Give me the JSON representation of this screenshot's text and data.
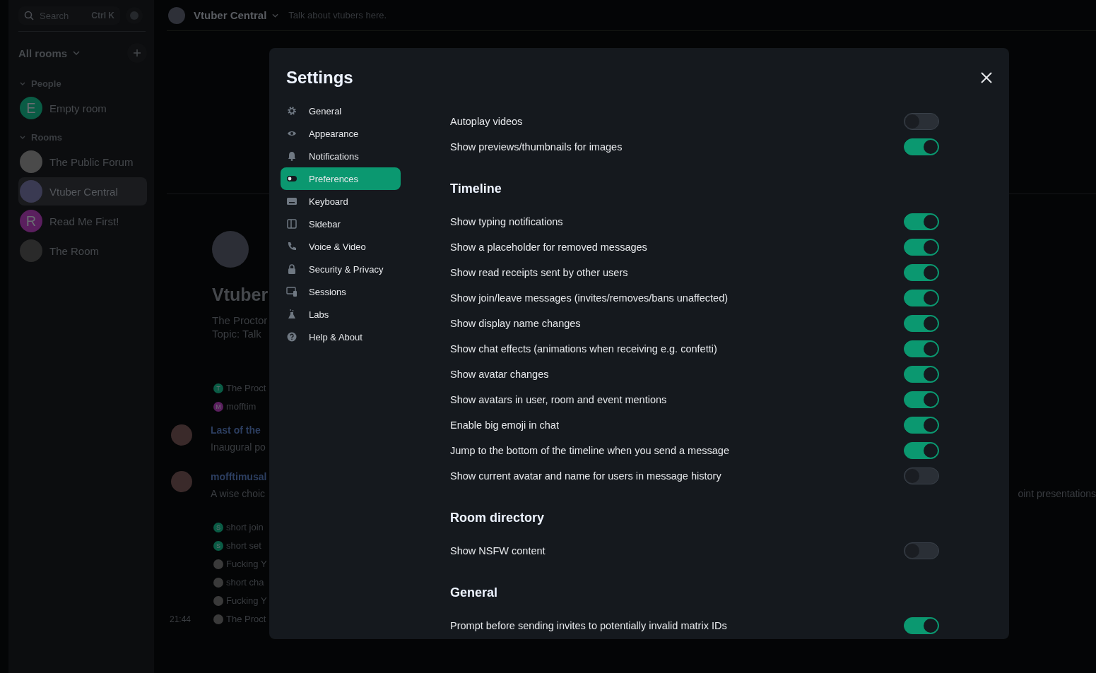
{
  "sidebar": {
    "search": {
      "placeholder": "Search",
      "shortcut": "Ctrl K"
    },
    "header": "All rooms",
    "sections": [
      {
        "title": "People",
        "rooms": [
          {
            "name": "Empty room",
            "letter": "E",
            "color": "#0a5c45",
            "selected": false
          }
        ]
      },
      {
        "title": "Rooms",
        "rooms": [
          {
            "name": "The Public Forum",
            "color": "#4a4a4a",
            "selected": false
          },
          {
            "name": "Vtuber Central",
            "color": "#3a3a52",
            "selected": true
          },
          {
            "name": "Read Me First!",
            "letter": "R",
            "color": "#5a1f5e",
            "selected": false
          },
          {
            "name": "The Room",
            "color": "#2a2a2a",
            "selected": false
          }
        ]
      }
    ]
  },
  "room_header": {
    "name": "Vtuber Central",
    "topic": "Talk about vtubers here."
  },
  "room_intro": {
    "name": "Vtuber",
    "creator": "The Proctor",
    "topic": "Topic: Talk"
  },
  "timeline": [
    {
      "kind": "event",
      "letter": "T",
      "color": "#0a5c45",
      "text": "The Proct"
    },
    {
      "kind": "event",
      "letter": "M",
      "color": "#5a1f5e",
      "text": "mofftim"
    },
    {
      "kind": "message",
      "sender": "Last of the",
      "body": "Inaugural po"
    },
    {
      "kind": "message",
      "sender": "mofftimusal",
      "body": "A wise choic",
      "tail": "oint presentations"
    },
    {
      "kind": "event",
      "letter": "S",
      "color": "#0a5c45",
      "text": "short join"
    },
    {
      "kind": "event",
      "letter": "S",
      "color": "#0a5c45",
      "text": "short set"
    },
    {
      "kind": "event",
      "color": "#3a3a3a",
      "text": "Fucking Y"
    },
    {
      "kind": "event",
      "color": "#3a3a3a",
      "text": "short cha"
    },
    {
      "kind": "event",
      "color": "#3a3a3a",
      "text": "Fucking Y"
    },
    {
      "kind": "event",
      "color": "#3a3a3a",
      "text": "The Proct",
      "time": "21:44"
    }
  ],
  "settings": {
    "title": "Settings",
    "nav": [
      {
        "label": "General",
        "selected": false
      },
      {
        "label": "Appearance",
        "selected": false
      },
      {
        "label": "Notifications",
        "selected": false
      },
      {
        "label": "Preferences",
        "selected": true
      },
      {
        "label": "Keyboard",
        "selected": false
      },
      {
        "label": "Sidebar",
        "selected": false
      },
      {
        "label": "Voice & Video",
        "selected": false
      },
      {
        "label": "Security & Privacy",
        "selected": false
      },
      {
        "label": "Sessions",
        "selected": false
      },
      {
        "label": "Labs",
        "selected": false
      },
      {
        "label": "Help & About",
        "selected": false
      }
    ],
    "sections": [
      {
        "rows": [
          {
            "label": "Autoplay videos",
            "on": false
          },
          {
            "label": "Show previews/thumbnails for images",
            "on": true
          }
        ]
      },
      {
        "title": "Timeline",
        "rows": [
          {
            "label": "Show typing notifications",
            "on": true
          },
          {
            "label": "Show a placeholder for removed messages",
            "on": true
          },
          {
            "label": "Show read receipts sent by other users",
            "on": true
          },
          {
            "label": "Show join/leave messages (invites/removes/bans unaffected)",
            "on": true
          },
          {
            "label": "Show display name changes",
            "on": true
          },
          {
            "label": "Show chat effects (animations when receiving e.g. confetti)",
            "on": true
          },
          {
            "label": "Show avatar changes",
            "on": true
          },
          {
            "label": "Show avatars in user, room and event mentions",
            "on": true
          },
          {
            "label": "Enable big emoji in chat",
            "on": true
          },
          {
            "label": "Jump to the bottom of the timeline when you send a message",
            "on": true
          },
          {
            "label": "Show current avatar and name for users in message history",
            "on": false
          }
        ]
      },
      {
        "title": "Room directory",
        "rows": [
          {
            "label": "Show NSFW content",
            "on": false
          }
        ]
      },
      {
        "title": "General",
        "rows": [
          {
            "label": "Prompt before sending invites to potentially invalid matrix IDs",
            "on": true
          }
        ]
      }
    ]
  }
}
